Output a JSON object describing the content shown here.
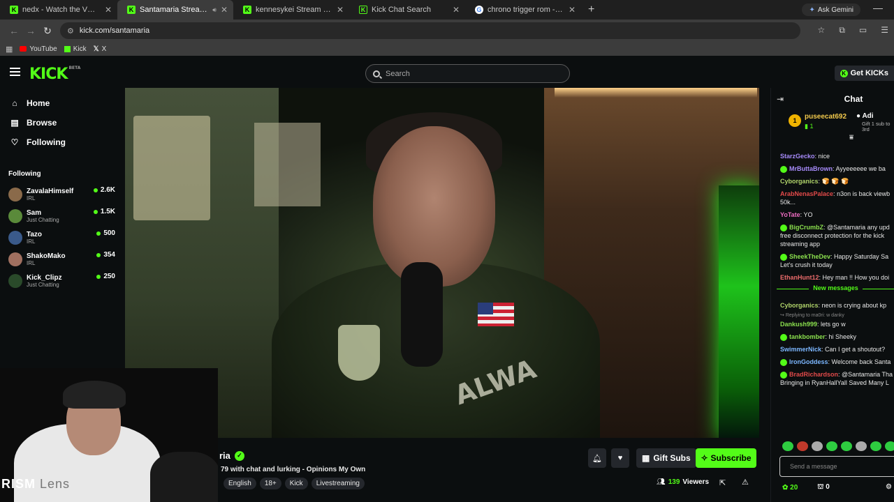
{
  "browser": {
    "tabs": [
      {
        "title": "nedx - Watch the VOD on Kick",
        "icon": "kick"
      },
      {
        "title": "Santamaria Stream - Watch",
        "icon": "kick",
        "active": true
      },
      {
        "title": "kennesykei Stream - Watch Live",
        "icon": "kick"
      },
      {
        "title": "Kick Chat Search",
        "icon": "kick-outline"
      },
      {
        "title": "chrono trigger rom - Google Se",
        "icon": "google"
      }
    ],
    "ask_gemini": "Ask Gemini",
    "url": "kick.com/santamaria",
    "bookmarks": [
      "YouTube",
      "Kick",
      "X"
    ]
  },
  "header": {
    "logo": "KICK",
    "logo_tag": "BETA",
    "search_placeholder": "Search",
    "get_kicks": "Get KICKs"
  },
  "sidebar": {
    "nav": [
      {
        "label": "Home",
        "icon": "home-icon"
      },
      {
        "label": "Browse",
        "icon": "browse-icon"
      },
      {
        "label": "Following",
        "icon": "heart-icon"
      }
    ],
    "following_label": "Following",
    "channels": [
      {
        "name": "ZavalaHimself",
        "category": "IRL",
        "viewers": "2.6K",
        "color": "#8a6a4a"
      },
      {
        "name": "Sam",
        "category": "Just Chatting",
        "viewers": "1.5K",
        "color": "#5a8a3a"
      },
      {
        "name": "Tazo",
        "category": "IRL",
        "viewers": "500",
        "color": "#3a5a8a"
      },
      {
        "name": "ShakoMako",
        "category": "IRL",
        "viewers": "354",
        "color": "#a07060"
      },
      {
        "name": "Kick_Clipz",
        "category": "Just Chatting",
        "viewers": "250",
        "color": "#2a4a2a"
      }
    ]
  },
  "webcam": {
    "label": "RISM",
    "label_dim": "Lens"
  },
  "stream": {
    "streamer": "ria",
    "title": "79 with chat and lurking - Opinions My Own",
    "tags": [
      "English",
      "18+",
      "Kick",
      "Livestreaming"
    ],
    "gift_subs": "Gift Subs",
    "subscribe": "Subscribe",
    "viewers_count": "139",
    "viewers_label": "Viewers"
  },
  "chat": {
    "title": "Chat",
    "pinned": {
      "rank": "1",
      "user": "puseecat692",
      "count": "1",
      "name": "Adi",
      "sub_line1": "Gift 1 sub to",
      "sub_line2": "3rd"
    },
    "messages": [
      {
        "user": "StarzGecko",
        "color": "#a78bfa",
        "text": "nice"
      },
      {
        "user": "MrButtaBrown",
        "color": "#a78bfa",
        "badge": true,
        "text": "Ayyeeeeee we ba"
      },
      {
        "user": "Cyborganics",
        "color": "#b0d36a",
        "text": "🍞 🍞 🍞"
      },
      {
        "user": "ArabNenasPalace",
        "color": "#e24a4a",
        "text": "n3on is back viewb",
        "cont": "50k..."
      },
      {
        "user": "YoTate",
        "color": "#ec6cc0",
        "text": "YO"
      },
      {
        "user": "BigCrumbZ",
        "color": "#8be04e",
        "badge": true,
        "text": "@Santamaria any upd",
        "cont": "free disconnect protection for the kick",
        "cont2": "streaming app"
      },
      {
        "user": "SheekTheDev",
        "color": "#8be04e",
        "badge": true,
        "text": "Happy Saturday Sa",
        "cont": "Let's crush it today"
      },
      {
        "user": "EthanHunt12",
        "color": "#ec6c6c",
        "text": "Hey man !! How you doi"
      }
    ],
    "new_messages_label": "New messages",
    "new_messages": [
      {
        "user": "Cyborganics",
        "color": "#b0d36a",
        "text": "neon is crying about kp"
      },
      {
        "reply": "Replying to ma0ri: w danky"
      },
      {
        "user": "Dankush999",
        "color": "#8be04e",
        "text": "lets go w"
      },
      {
        "user": "tankbomber",
        "color": "#8be04e",
        "badge": true,
        "text": "hi Sheeky"
      },
      {
        "user": "SwimmerNick",
        "color": "#7cb7ff",
        "text": "Can I get a shoutout?"
      },
      {
        "user": "IronGoddess",
        "color": "#7cb7ff",
        "badge": true,
        "text": "Welcome back Santa"
      },
      {
        "user": "BradRichardson",
        "color": "#e24a4a",
        "badge": true,
        "text": "@Santamaria Tha",
        "cont": "Bringing in RyanHallYall Saved Many L"
      }
    ],
    "input_placeholder": "Send a message",
    "points": "20",
    "drops": "0"
  }
}
